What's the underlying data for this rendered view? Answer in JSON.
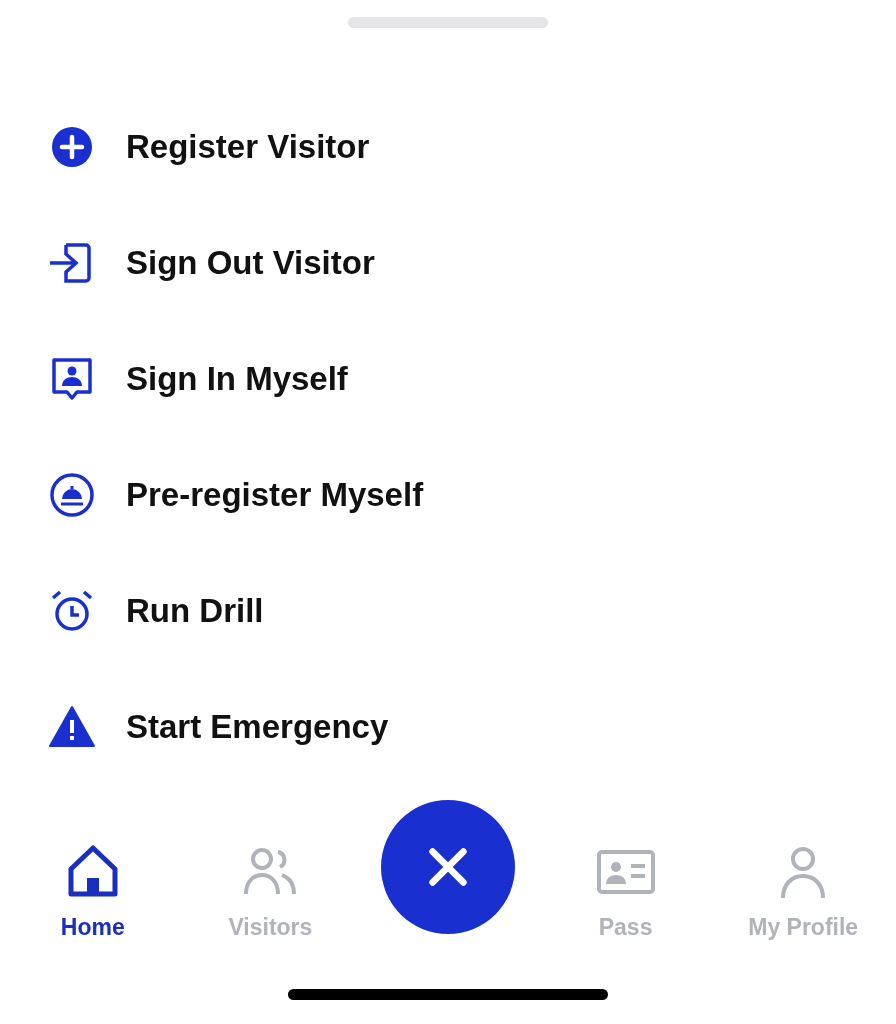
{
  "menu": [
    {
      "kind": "plus",
      "label": "Register Visitor"
    },
    {
      "kind": "sign-out",
      "label": "Sign Out Visitor"
    },
    {
      "kind": "person-badge",
      "label": "Sign In Myself"
    },
    {
      "kind": "bell",
      "label": "Pre-register Myself"
    },
    {
      "kind": "alarm",
      "label": "Run Drill"
    },
    {
      "kind": "warning",
      "label": "Start Emergency"
    }
  ],
  "tabs": [
    {
      "kind": "home",
      "label": "Home",
      "selected": true
    },
    {
      "kind": "people",
      "label": "Visitors",
      "selected": false
    },
    {
      "kind": "card",
      "label": "Pass",
      "selected": false
    },
    {
      "kind": "person",
      "label": "My Profile",
      "selected": false
    }
  ]
}
